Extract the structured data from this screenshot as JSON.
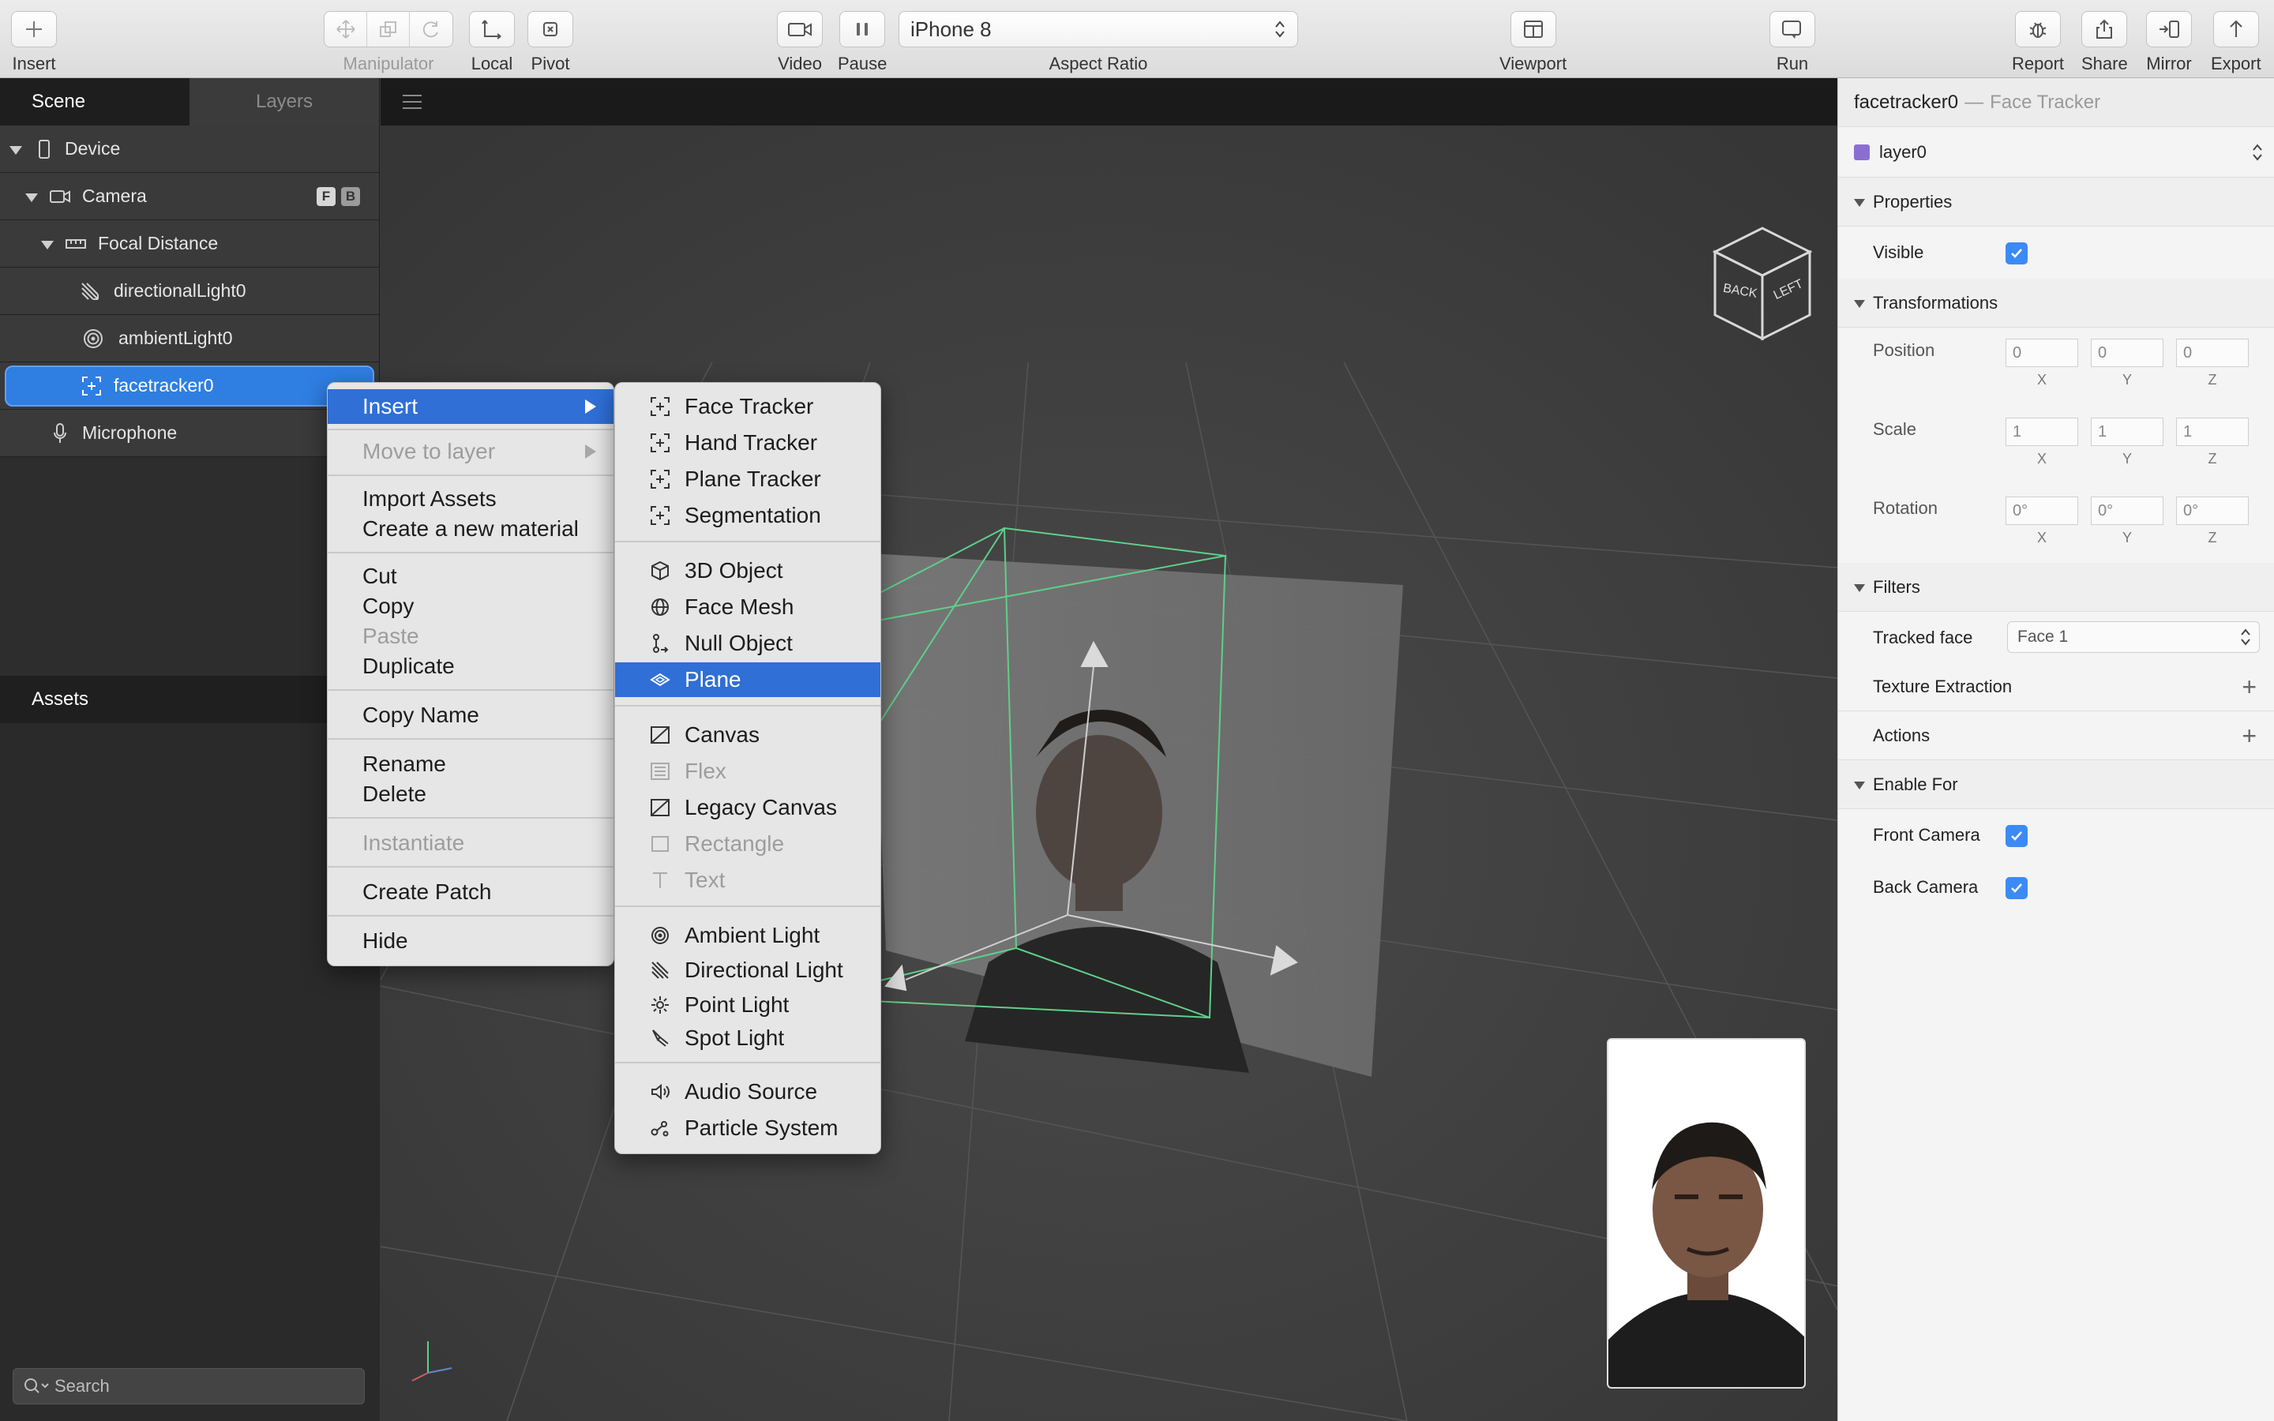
{
  "toolbar": {
    "insert": "Insert",
    "manipulator": "Manipulator",
    "local": "Local",
    "pivot": "Pivot",
    "video": "Video",
    "pause": "Pause",
    "device_value": "iPhone 8",
    "aspect_ratio": "Aspect Ratio",
    "viewport": "Viewport",
    "run": "Run",
    "report": "Report",
    "share": "Share",
    "mirror": "Mirror",
    "export": "Export"
  },
  "left_panel": {
    "tabs": [
      "Scene",
      "Layers"
    ],
    "tree": [
      {
        "label": "Device",
        "icon": "phone-icon"
      },
      {
        "label": "Camera",
        "icon": "camera-icon",
        "badges": [
          "F",
          "B"
        ]
      },
      {
        "label": "Focal Distance",
        "icon": "ruler-icon"
      },
      {
        "label": "directionalLight0",
        "icon": "directional-light-icon"
      },
      {
        "label": "ambientLight0",
        "icon": "ambient-light-icon"
      },
      {
        "label": "facetracker0",
        "icon": "face-tracker-icon",
        "selected": true
      },
      {
        "label": "Microphone",
        "icon": "microphone-icon"
      }
    ],
    "assets_title": "Assets",
    "search_placeholder": "Search"
  },
  "context_menu": {
    "items": [
      {
        "label": "Insert",
        "state": "highlighted",
        "submenu": true
      },
      {
        "label": "Move to layer",
        "state": "disabled",
        "submenu": true
      },
      {
        "label": "Import Assets",
        "state": "enabled"
      },
      {
        "label": "Create a new material",
        "state": "enabled"
      },
      {
        "label": "Cut",
        "state": "enabled"
      },
      {
        "label": "Copy",
        "state": "enabled"
      },
      {
        "label": "Paste",
        "state": "disabled"
      },
      {
        "label": "Duplicate",
        "state": "enabled"
      },
      {
        "label": "Copy Name",
        "state": "enabled"
      },
      {
        "label": "Rename",
        "state": "enabled"
      },
      {
        "label": "Delete",
        "state": "enabled"
      },
      {
        "label": "Instantiate",
        "state": "disabled"
      },
      {
        "label": "Create Patch",
        "state": "enabled"
      },
      {
        "label": "Hide",
        "state": "enabled"
      }
    ]
  },
  "insert_submenu": {
    "items": [
      {
        "label": "Face Tracker",
        "icon": "tracker-icon",
        "state": "enabled"
      },
      {
        "label": "Hand Tracker",
        "icon": "tracker-icon",
        "state": "enabled"
      },
      {
        "label": "Plane Tracker",
        "icon": "tracker-icon",
        "state": "enabled"
      },
      {
        "label": "Segmentation",
        "icon": "tracker-icon",
        "state": "enabled"
      },
      {
        "label": "3D Object",
        "icon": "cube-icon",
        "state": "enabled"
      },
      {
        "label": "Face Mesh",
        "icon": "globe-icon",
        "state": "enabled"
      },
      {
        "label": "Null Object",
        "icon": "null-object-icon",
        "state": "enabled"
      },
      {
        "label": "Plane",
        "icon": "plane-icon",
        "state": "highlighted"
      },
      {
        "label": "Canvas",
        "icon": "canvas-icon",
        "state": "enabled"
      },
      {
        "label": "Flex",
        "icon": "flex-icon",
        "state": "disabled"
      },
      {
        "label": "Legacy Canvas",
        "icon": "canvas-icon",
        "state": "enabled"
      },
      {
        "label": "Rectangle",
        "icon": "rectangle-icon",
        "state": "disabled"
      },
      {
        "label": "Text",
        "icon": "text-icon",
        "state": "disabled"
      },
      {
        "label": "Ambient Light",
        "icon": "ambient-light-icon",
        "state": "enabled"
      },
      {
        "label": "Directional Light",
        "icon": "directional-light-icon",
        "state": "enabled"
      },
      {
        "label": "Point Light",
        "icon": "point-light-icon",
        "state": "enabled"
      },
      {
        "label": "Spot Light",
        "icon": "spot-light-icon",
        "state": "enabled"
      },
      {
        "label": "Audio Source",
        "icon": "speaker-icon",
        "state": "enabled"
      },
      {
        "label": "Particle System",
        "icon": "particles-icon",
        "state": "enabled"
      }
    ]
  },
  "viewport": {
    "cube_labels": [
      "BACK",
      "LEFT"
    ]
  },
  "inspector": {
    "object_name": "facetracker0",
    "separator": "—",
    "object_type": "Face Tracker",
    "layer": "layer0",
    "layer_color": "#8b6fd0",
    "sections": {
      "properties": "Properties",
      "transformations": "Transformations",
      "filters": "Filters",
      "texture_extraction": "Texture Extraction",
      "actions": "Actions",
      "enable_for": "Enable For"
    },
    "visible_label": "Visible",
    "visible": true,
    "position_label": "Position",
    "position": [
      "0",
      "0",
      "0"
    ],
    "scale_label": "Scale",
    "scale": [
      "1",
      "1",
      "1"
    ],
    "rotation_label": "Rotation",
    "rotation": [
      "0°",
      "0°",
      "0°"
    ],
    "axes": [
      "X",
      "Y",
      "Z"
    ],
    "tracked_face_label": "Tracked face",
    "tracked_face_value": "Face 1",
    "front_camera_label": "Front Camera",
    "front_camera": true,
    "back_camera_label": "Back Camera",
    "back_camera": true
  },
  "colors": {
    "accent": "#2f6fd6",
    "selection": "#2f7ee2",
    "checkbox": "#3c8af5"
  }
}
